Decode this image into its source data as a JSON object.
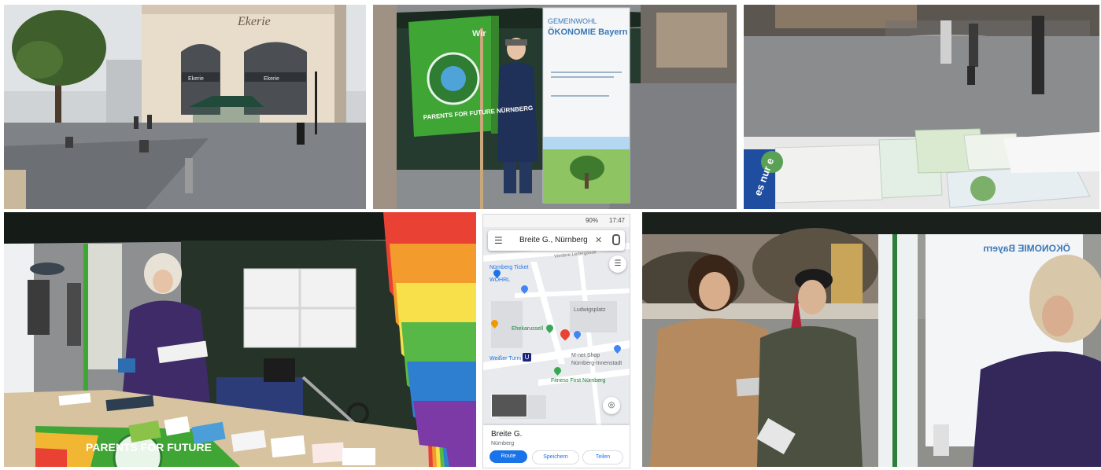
{
  "photos": {
    "shop_sign": "Ekerie",
    "shop_sign_small": "Ekerie",
    "flag_banner": "PARENTS FOR FUTURE NÜRNBERG",
    "flag_banner_side": "Wir",
    "gwo_banner_title_line1": "GEMEINWOHL",
    "gwo_banner_title_line2": "ÖKONOMIE Bayern",
    "table_banner": "PARENTS FOR FUTURE",
    "flyer_text": "es nur e"
  },
  "map": {
    "status_time": "17:47",
    "status_battery": "90%",
    "search_query": "Breite G., Nürnberg",
    "labels": {
      "nuernberg_ticket": "Nürnberg Ticket",
      "woehrl": "WÖHRL",
      "ludwigsplatz": "Ludwigsplatz",
      "ehekarussell": "Ehekarussell",
      "weisser_turm": "Weißer Turm",
      "mnet_shop_1": "M-net Shop",
      "mnet_shop_2": "Nürnberg-Innenstadt",
      "fitness": "Fitness First Nürnberg",
      "street_top": "Vordere Ledergasse"
    },
    "place_name": "Breite G.",
    "place_city": "Nürnberg",
    "btn_route": "Route",
    "btn_save": "Speichern",
    "btn_share": "Teilen"
  },
  "colors": {
    "flag_green": "#3fa535",
    "gwo_blue": "#3b78b8",
    "tent_dark": "#1f2a22",
    "map_blue": "#1a73e8",
    "pin_red": "#ea4335"
  }
}
